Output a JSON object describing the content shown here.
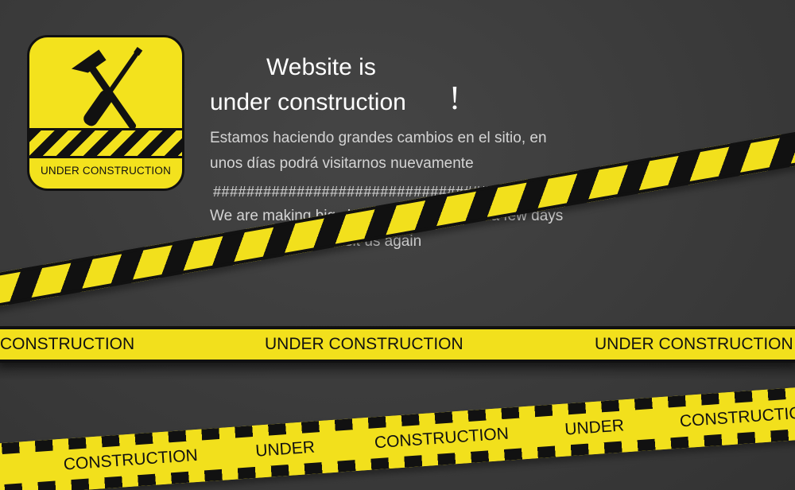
{
  "sign": {
    "icon": "hammer-and-screwdriver-icon",
    "label": "UNDER CONSTRUCTION",
    "color": "#f3e21d"
  },
  "headline": {
    "line1": "Website is",
    "line2": "under construction",
    "exclamation": "!"
  },
  "message_es": {
    "line1": "Estamos haciendo grandes cambios en el sitio, en",
    "line2": "unos días podrá visitarnos nuevamente"
  },
  "separator": "#############################################",
  "message_en": {
    "line1": "We are making big changes to the site, in a few days",
    "line2": "you will be able to visit us again"
  },
  "tapes": {
    "middle": [
      "CONSTRUCTION",
      "UNDER CONSTRUCTION",
      "UNDER CONSTRUCTION"
    ],
    "bottom": [
      "CONSTRUCTION",
      "UNDER",
      "CONSTRUCTION",
      "UNDER",
      "CONSTRUCTIO"
    ],
    "color": "#f2e01c"
  }
}
